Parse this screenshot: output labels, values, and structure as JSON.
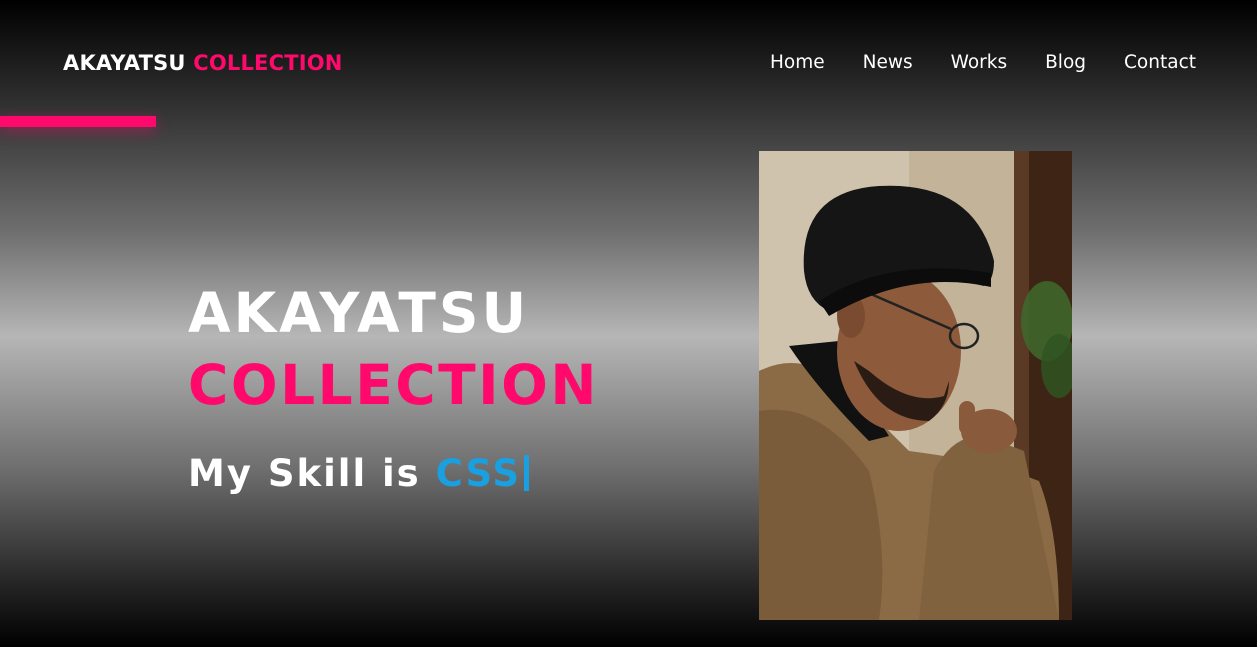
{
  "header": {
    "logo_primary": "AKAYATSU",
    "logo_accent": "COLLECTION",
    "nav": [
      {
        "label": "Home"
      },
      {
        "label": "News"
      },
      {
        "label": "Works"
      },
      {
        "label": "Blog"
      },
      {
        "label": "Contact"
      }
    ]
  },
  "hero": {
    "title_line1": "AKAYATSU",
    "title_line2": "COLLECTION",
    "skill_prefix": "My Skill is",
    "skill_value": "CSS"
  },
  "colors": {
    "accent_pink": "#ff0a6c",
    "skill_blue": "#1a9fe0",
    "text_white": "#ffffff"
  },
  "images": {
    "hero_photo": "man-in-beanie-and-glasses-thinking"
  }
}
